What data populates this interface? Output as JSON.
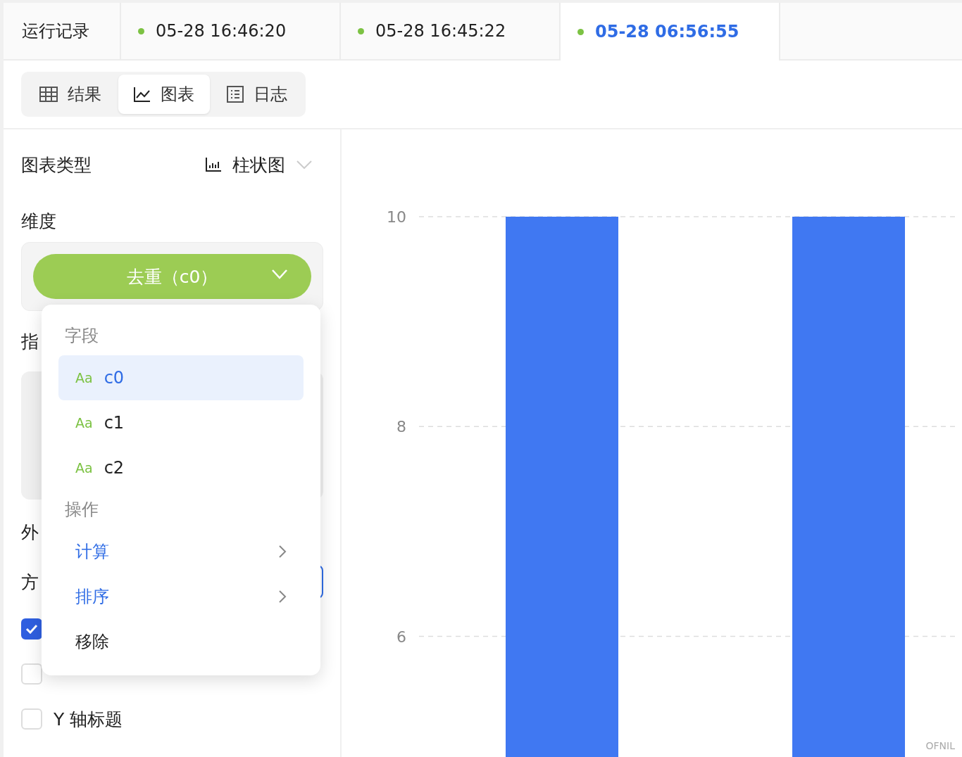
{
  "run_tabs": {
    "title": "运行记录",
    "runs": [
      {
        "time": "05-28 16:46:20",
        "color": "#7cc243",
        "selected": false
      },
      {
        "time": "05-28 16:45:22",
        "color": "#7cc243",
        "selected": false
      },
      {
        "time": "05-28 06:56:55",
        "color": "#7cc243",
        "selected": true
      }
    ]
  },
  "view_tabs": [
    {
      "label": "结果",
      "selected": false
    },
    {
      "label": "图表",
      "selected": true
    },
    {
      "label": "日志",
      "selected": false
    }
  ],
  "settings": {
    "chart_type": {
      "label": "图表类型",
      "value": "柱状图"
    },
    "dimension": {
      "label": "维度",
      "chip": "去重（c0）"
    },
    "metric_label": "指",
    "appearance_label": "外",
    "direction_label": "方",
    "checkboxes": [
      {
        "checked": true
      },
      {
        "checked": false
      },
      {
        "label": "Y 轴标题",
        "checked": false
      }
    ]
  },
  "menu": {
    "sections": [
      {
        "title": "字段",
        "items": [
          {
            "kind": "field",
            "type_label": "Aa",
            "label": "c0",
            "selected": true
          },
          {
            "kind": "field",
            "type_label": "Aa",
            "label": "c1",
            "selected": false
          },
          {
            "kind": "field",
            "type_label": "Aa",
            "label": "c2",
            "selected": false
          }
        ]
      },
      {
        "title": "操作",
        "items": [
          {
            "kind": "submenu",
            "label": "计算"
          },
          {
            "kind": "submenu",
            "label": "排序"
          },
          {
            "kind": "action",
            "label": "移除"
          }
        ]
      }
    ]
  },
  "chart": {
    "corner_mark": "OFNIL",
    "chart_data": {
      "type": "bar",
      "values": [
        10,
        10
      ],
      "yticks": [
        6,
        8,
        10
      ],
      "ylim": [
        4.85,
        10
      ],
      "grid": true
    }
  }
}
